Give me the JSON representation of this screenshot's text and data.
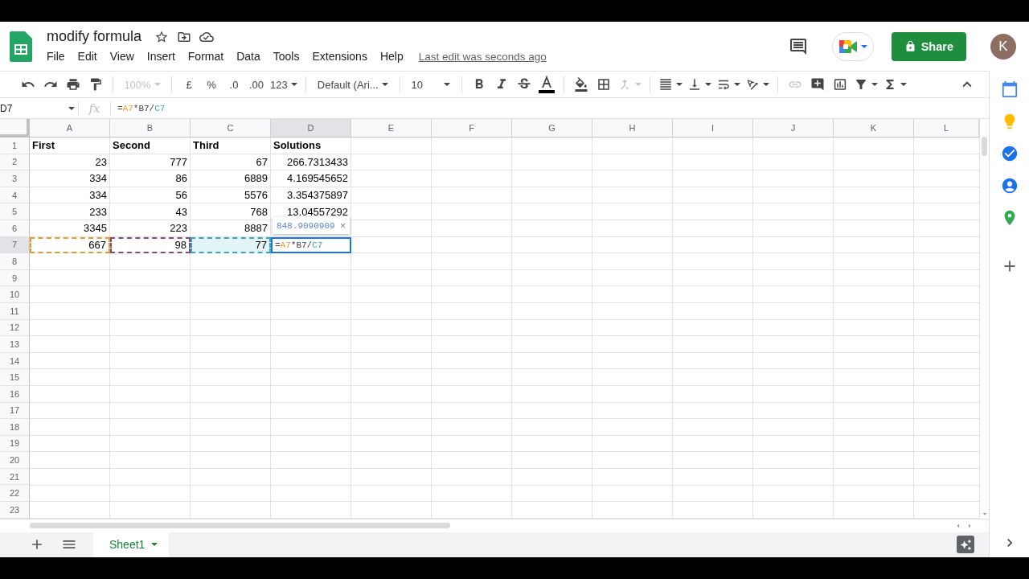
{
  "document": {
    "title": "modify formula",
    "menu": [
      "File",
      "Edit",
      "View",
      "Insert",
      "Format",
      "Data",
      "Tools",
      "Extensions",
      "Help"
    ],
    "last_edit": "Last edit was seconds ago",
    "share": "Share",
    "avatar": "K"
  },
  "toolbar": {
    "zoom": {
      "text": "100%",
      "disabled": true
    },
    "currency": "£",
    "percent": "%",
    "decrease_decimals": ".0",
    "increase_decimals": ".00",
    "number_format": "123",
    "font": "Default (Ari...",
    "font_size": "10",
    "merge_disabled": true,
    "link_disabled": true
  },
  "formula_bar": {
    "cell_ref": "D7",
    "fx": "fx",
    "formula": [
      {
        "text": "="
      },
      {
        "text": "A7",
        "color": "#e39d2b"
      },
      {
        "text": "*B7/"
      },
      {
        "text": "C7",
        "color": "#3aa5b8"
      }
    ]
  },
  "columns": [
    {
      "label": "A",
      "selected": false
    },
    {
      "label": "B",
      "selected": false
    },
    {
      "label": "C",
      "selected": false
    },
    {
      "label": "D",
      "selected": true
    },
    {
      "label": "E",
      "selected": false
    },
    {
      "label": "F",
      "selected": false
    },
    {
      "label": "G",
      "selected": false
    },
    {
      "label": "H",
      "selected": false
    },
    {
      "label": "I",
      "selected": false
    },
    {
      "label": "J",
      "selected": false
    },
    {
      "label": "K",
      "selected": false
    },
    {
      "label": "L",
      "selected": false
    }
  ],
  "rows": [
    {
      "number": "1",
      "selected": false,
      "cells": [
        {
          "text": "First",
          "kind": "label"
        },
        {
          "text": "Second",
          "kind": "label"
        },
        {
          "text": "Third",
          "kind": "label"
        },
        {
          "text": "Solutions",
          "kind": "label"
        }
      ]
    },
    {
      "number": "2",
      "selected": false,
      "cells": [
        {
          "text": "23",
          "kind": "number"
        },
        {
          "text": "777",
          "kind": "number"
        },
        {
          "text": "67",
          "kind": "number"
        },
        {
          "text": "266.7313433",
          "kind": "number"
        }
      ]
    },
    {
      "number": "3",
      "selected": false,
      "cells": [
        {
          "text": "334",
          "kind": "number"
        },
        {
          "text": "86",
          "kind": "number"
        },
        {
          "text": "6889",
          "kind": "number"
        },
        {
          "text": "4.169545652",
          "kind": "number"
        }
      ]
    },
    {
      "number": "4",
      "selected": false,
      "cells": [
        {
          "text": "334",
          "kind": "number"
        },
        {
          "text": "56",
          "kind": "number"
        },
        {
          "text": "5576",
          "kind": "number"
        },
        {
          "text": "3.354375897",
          "kind": "number"
        }
      ]
    },
    {
      "number": "5",
      "selected": false,
      "cells": [
        {
          "text": "233",
          "kind": "number"
        },
        {
          "text": "43",
          "kind": "number"
        },
        {
          "text": "768",
          "kind": "number"
        },
        {
          "text": "13.04557292",
          "kind": "number"
        }
      ]
    },
    {
      "number": "6",
      "selected": false,
      "cells": [
        {
          "text": "3345",
          "kind": "number"
        },
        {
          "text": "223",
          "kind": "number"
        },
        {
          "text": "8887",
          "kind": "number"
        }
      ]
    },
    {
      "number": "7",
      "selected": true,
      "cells": [
        {
          "text": "667",
          "kind": "number",
          "color": "#e39d2b",
          "highlighted": false
        },
        {
          "text": "98",
          "kind": "number",
          "color": "#7b4d7b",
          "highlighted": false
        },
        {
          "text": "77",
          "kind": "number",
          "color": "#3aa5b8",
          "highlighted": true
        },
        {
          "kind": "editor",
          "parts": [
            {
              "text": "="
            },
            {
              "text": "A7",
              "color": "#e39d2b"
            },
            {
              "text": "*B7/"
            },
            {
              "text": "C7",
              "color": "#3aa5b8"
            }
          ],
          "preview": "848.9090909",
          "close": "×"
        }
      ]
    },
    {
      "number": "8",
      "selected": false
    },
    {
      "number": "9",
      "selected": false
    },
    {
      "number": "10",
      "selected": false
    },
    {
      "number": "11",
      "selected": false
    },
    {
      "number": "12",
      "selected": false
    },
    {
      "number": "13",
      "selected": false
    },
    {
      "number": "14",
      "selected": false
    },
    {
      "number": "15",
      "selected": false
    },
    {
      "number": "16",
      "selected": false
    },
    {
      "number": "17",
      "selected": false
    },
    {
      "number": "18",
      "selected": false
    },
    {
      "number": "19",
      "selected": false
    },
    {
      "number": "20",
      "selected": false
    },
    {
      "number": "21",
      "selected": false
    },
    {
      "number": "22",
      "selected": false
    },
    {
      "number": "23",
      "selected": false
    }
  ],
  "sheet_tabs": [
    {
      "label": "Sheet1",
      "selected": true
    }
  ]
}
